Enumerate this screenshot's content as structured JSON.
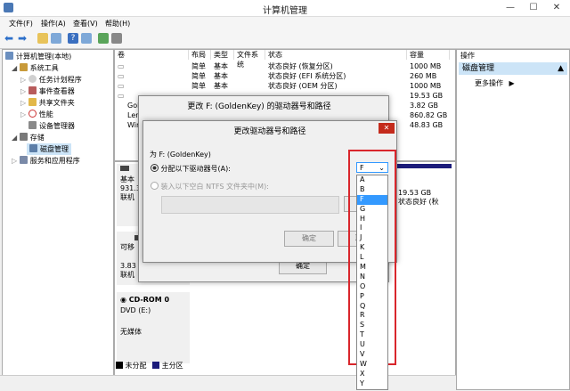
{
  "window": {
    "title": "计算机管理",
    "minimize": "—",
    "maximize": "☐",
    "close": "✕"
  },
  "menu": [
    {
      "label": "文件(F)"
    },
    {
      "label": "操作(A)"
    },
    {
      "label": "查看(V)"
    },
    {
      "label": "帮助(H)"
    }
  ],
  "tree": {
    "root": "计算机管理(本地)",
    "system_tools": "系统工具",
    "task_scheduler": "任务计划程序",
    "event_viewer": "事件查看器",
    "shared_folders": "共享文件夹",
    "performance": "性能",
    "device_manager": "设备管理器",
    "storage": "存储",
    "disk_management": "磁盘管理",
    "services": "服务和应用程序"
  },
  "table": {
    "headers": {
      "volume": "卷",
      "layout": "布局",
      "type": "类型",
      "fs": "文件系统",
      "status": "状态",
      "capacity": "容量"
    },
    "rows": [
      {
        "volume": "",
        "layout": "简单",
        "type": "基本",
        "fs": "",
        "status": "状态良好 (恢复分区)",
        "capacity": "1000 MB"
      },
      {
        "volume": "",
        "layout": "简单",
        "type": "基本",
        "fs": "",
        "status": "状态良好 (EFI 系统分区)",
        "capacity": "260 MB"
      },
      {
        "volume": "",
        "layout": "简单",
        "type": "基本",
        "fs": "",
        "status": "状态良好 (OEM 分区)",
        "capacity": "1000 MB"
      },
      {
        "volume": "",
        "layout": "",
        "type": "",
        "fs": "",
        "status": "",
        "capacity": "19.53 GB"
      },
      {
        "volume": "Gol",
        "layout": "",
        "type": "",
        "fs": "",
        "status": "",
        "capacity": "3.82 GB"
      },
      {
        "volume": "Len",
        "layout": "",
        "type": "",
        "fs": "",
        "status": "",
        "capacity": "860.82 GB"
      },
      {
        "volume": "Wir",
        "layout": "",
        "type": "",
        "fs": "",
        "status": "",
        "capacity": "48.83 GB"
      }
    ]
  },
  "actions": {
    "header": "操作",
    "section": "磁盘管理",
    "more": "更多操作"
  },
  "disks": {
    "disk0": {
      "type": "基本",
      "size": "931.3",
      "status": "联机",
      "part_size": "19.53 GB",
      "part_status": "状态良好 (秋"
    },
    "disk1": {
      "type": "可移",
      "size": "3.83",
      "status": "联机"
    },
    "cdrom": {
      "name": "CD-ROM 0",
      "drive": "DVD (E:)",
      "media": "无媒体"
    }
  },
  "legend": {
    "unallocated": "未分配",
    "primary": "主分区"
  },
  "outer_dialog": {
    "title": "更改 F: (GoldenKey) 的驱动器号和路径",
    "ok": "确定"
  },
  "inner_dialog": {
    "title": "更改驱动器号和路径",
    "for_label": "为 F: (GoldenKey)",
    "assign_label": "分配以下驱动器号(A):",
    "mount_label": "装入以下空白 NTFS 文件夹中(M):",
    "browse": "浏览",
    "ok": "确定",
    "cancel": "取消",
    "close": "✕"
  },
  "dropdown": {
    "selected": "F",
    "options": [
      "A",
      "B",
      "F",
      "G",
      "H",
      "I",
      "J",
      "K",
      "L",
      "M",
      "N",
      "O",
      "P",
      "Q",
      "R",
      "S",
      "T",
      "U",
      "V",
      "W",
      "X",
      "Y"
    ],
    "highlight_index": 2
  },
  "colors": {
    "highlight_box": "#d9262c",
    "selection": "#3399ff",
    "unallocated": "#000000",
    "primary": "#1b1b7a",
    "tree_selected": "#cce4f7",
    "title_close": "#c42b1c"
  }
}
